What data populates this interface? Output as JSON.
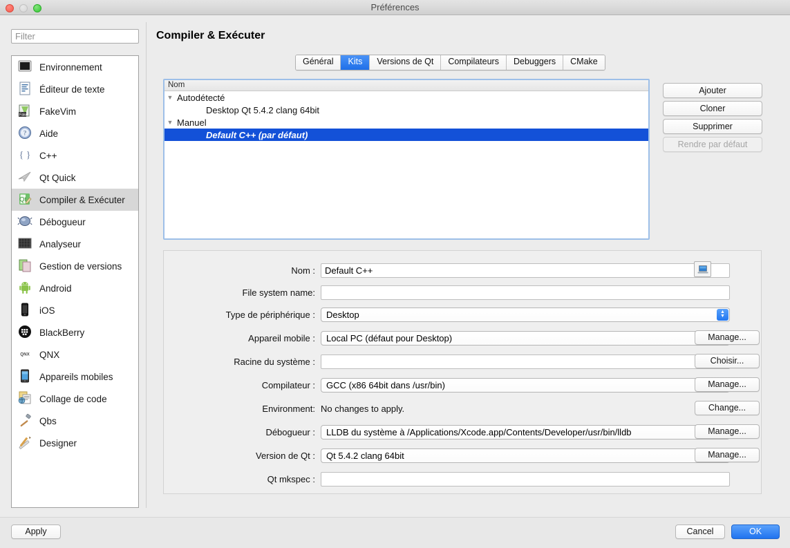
{
  "window": {
    "title": "Préférences",
    "traffic_lights": [
      "close-button",
      "minimize-button",
      "zoom-button"
    ]
  },
  "filter": {
    "placeholder": "Filter",
    "value": ""
  },
  "sidebar": {
    "items": [
      {
        "label": "Environnement",
        "icon": "environment-icon",
        "selected": false
      },
      {
        "label": "Éditeur de texte",
        "icon": "text-editor-icon",
        "selected": false
      },
      {
        "label": "FakeVim",
        "icon": "fakevim-icon",
        "selected": false
      },
      {
        "label": "Aide",
        "icon": "help-icon",
        "selected": false
      },
      {
        "label": "C++",
        "icon": "cpp-icon",
        "selected": false
      },
      {
        "label": "Qt Quick",
        "icon": "qt-quick-icon",
        "selected": false
      },
      {
        "label": "Compiler & Exécuter",
        "icon": "build-run-icon",
        "selected": true
      },
      {
        "label": "Débogueur",
        "icon": "debugger-icon",
        "selected": false
      },
      {
        "label": "Analyseur",
        "icon": "analyzer-icon",
        "selected": false
      },
      {
        "label": "Gestion de versions",
        "icon": "version-control-icon",
        "selected": false
      },
      {
        "label": "Android",
        "icon": "android-icon",
        "selected": false
      },
      {
        "label": "iOS",
        "icon": "ios-icon",
        "selected": false
      },
      {
        "label": "BlackBerry",
        "icon": "blackberry-icon",
        "selected": false
      },
      {
        "label": "QNX",
        "icon": "qnx-icon",
        "selected": false
      },
      {
        "label": "Appareils mobiles",
        "icon": "mobile-devices-icon",
        "selected": false
      },
      {
        "label": "Collage de code",
        "icon": "code-pasting-icon",
        "selected": false
      },
      {
        "label": "Qbs",
        "icon": "qbs-icon",
        "selected": false
      },
      {
        "label": "Designer",
        "icon": "designer-icon",
        "selected": false
      }
    ]
  },
  "page": {
    "title": "Compiler & Exécuter"
  },
  "tabs": [
    {
      "label": "Général",
      "active": false
    },
    {
      "label": "Kits",
      "active": true
    },
    {
      "label": "Versions de Qt",
      "active": false
    },
    {
      "label": "Compilateurs",
      "active": false
    },
    {
      "label": "Debuggers",
      "active": false
    },
    {
      "label": "CMake",
      "active": false
    }
  ],
  "kit_list": {
    "column_header": "Nom",
    "rows": [
      {
        "label": "Autodétecté",
        "level": 0,
        "expanded": true,
        "selected": false
      },
      {
        "label": "Desktop Qt 5.4.2 clang 64bit",
        "level": 1,
        "expanded": null,
        "selected": false
      },
      {
        "label": "Manuel",
        "level": 0,
        "expanded": true,
        "selected": false
      },
      {
        "label": "Default C++ (par défaut)",
        "level": 1,
        "expanded": null,
        "selected": true
      }
    ],
    "twisty_glyph": "▼"
  },
  "kit_actions": [
    {
      "label": "Ajouter",
      "disabled": false
    },
    {
      "label": "Cloner",
      "disabled": false
    },
    {
      "label": "Supprimer",
      "disabled": false
    },
    {
      "label": "Rendre par défaut",
      "disabled": true
    }
  ],
  "form": {
    "rows": [
      {
        "label": "Nom :",
        "type": "text",
        "value": "Default C++",
        "placeholder": "",
        "side_button": ""
      },
      {
        "label": "File system name:",
        "type": "text",
        "value": "",
        "placeholder": "",
        "side_button": ""
      },
      {
        "label": "Type de périphérique :",
        "type": "combo",
        "value": "Desktop",
        "placeholder": "",
        "side_button": ""
      },
      {
        "label": "Appareil mobile :",
        "type": "combo",
        "value": "Local PC (défaut pour Desktop)",
        "placeholder": "",
        "side_button": "Manage..."
      },
      {
        "label": "Racine du système :",
        "type": "text",
        "value": "",
        "placeholder": "",
        "side_button": "Choisir..."
      },
      {
        "label": "Compilateur :",
        "type": "combo",
        "value": "GCC (x86 64bit dans /usr/bin)",
        "placeholder": "",
        "side_button": "Manage..."
      },
      {
        "label": "Environment:",
        "type": "static",
        "value": "No changes to apply.",
        "placeholder": "",
        "side_button": "Change..."
      },
      {
        "label": "Débogueur :",
        "type": "combo",
        "value": "LLDB du système à /Applications/Xcode.app/Contents/Developer/usr/bin/lldb",
        "placeholder": "",
        "side_button": "Manage..."
      },
      {
        "label": "Version de Qt :",
        "type": "combo",
        "value": "Qt 5.4.2 clang 64bit",
        "placeholder": "",
        "side_button": "Manage..."
      },
      {
        "label": "Qt mkspec :",
        "type": "text",
        "value": "",
        "placeholder": "",
        "side_button": ""
      }
    ],
    "device_icon_button": "device-icon",
    "stepper_up": "▲",
    "stepper_down": "▼"
  },
  "footer": {
    "apply_label": "Apply",
    "cancel_label": "Cancel",
    "ok_label": "OK"
  },
  "colors": {
    "accent_blue": "#1f6fe8",
    "selection_blue": "#1351d8",
    "window_bg": "#ececec",
    "panel_bg": "#efefef"
  }
}
